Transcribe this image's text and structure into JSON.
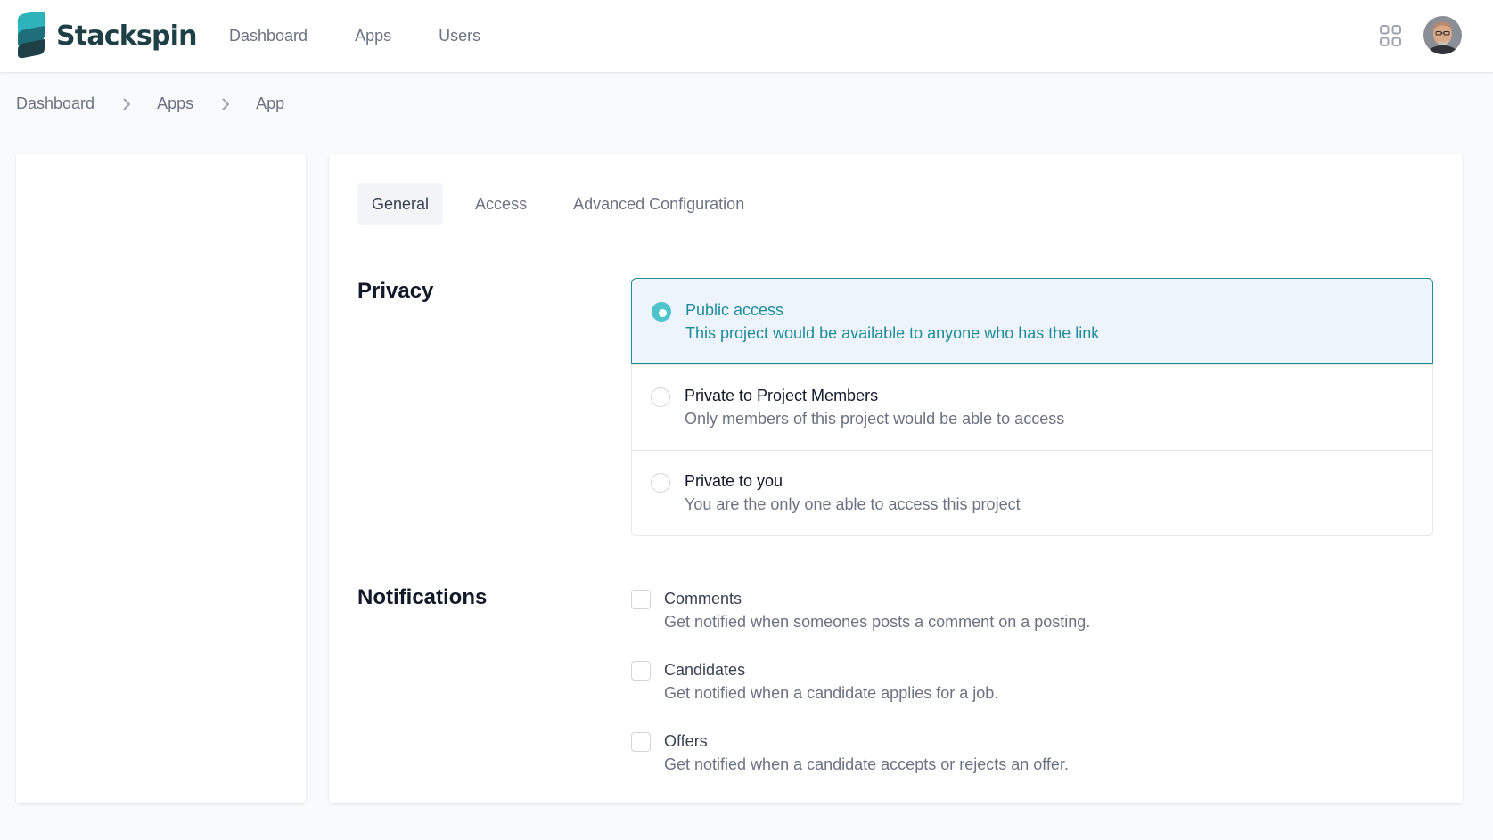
{
  "app": {
    "brand": "Stackspin",
    "colors": {
      "accent": "#1f8a99",
      "radio_fill": "#4fc3cc",
      "selected_bg": "#eef4fc",
      "logo_text": "#1f3f46"
    }
  },
  "header": {
    "nav": [
      {
        "label": "Dashboard"
      },
      {
        "label": "Apps"
      },
      {
        "label": "Users"
      }
    ],
    "icons": [
      "apps-grid-icon",
      "user-avatar"
    ]
  },
  "breadcrumb": {
    "items": [
      {
        "label": "Dashboard"
      },
      {
        "label": "Apps"
      },
      {
        "label": "App"
      }
    ]
  },
  "main": {
    "tabs": [
      {
        "label": "General",
        "active": true
      },
      {
        "label": "Access",
        "active": false
      },
      {
        "label": "Advanced Configuration",
        "active": false
      }
    ],
    "privacy": {
      "title": "Privacy",
      "selected": "Public access",
      "options": [
        {
          "label": "Public access",
          "description": "This project would be available to anyone who has the link",
          "selected": true
        },
        {
          "label": "Private to Project Members",
          "description": "Only members of this project would be able to access",
          "selected": false
        },
        {
          "label": "Private to you",
          "description": "You are the only one able to access this project",
          "selected": false
        }
      ]
    },
    "notifications": {
      "title": "Notifications",
      "items": [
        {
          "label": "Comments",
          "description": "Get notified when someones posts a comment on a posting.",
          "checked": false
        },
        {
          "label": "Candidates",
          "description": "Get notified when a candidate applies for a job.",
          "checked": false
        },
        {
          "label": "Offers",
          "description": "Get notified when a candidate accepts or rejects an offer.",
          "checked": false
        }
      ]
    }
  }
}
